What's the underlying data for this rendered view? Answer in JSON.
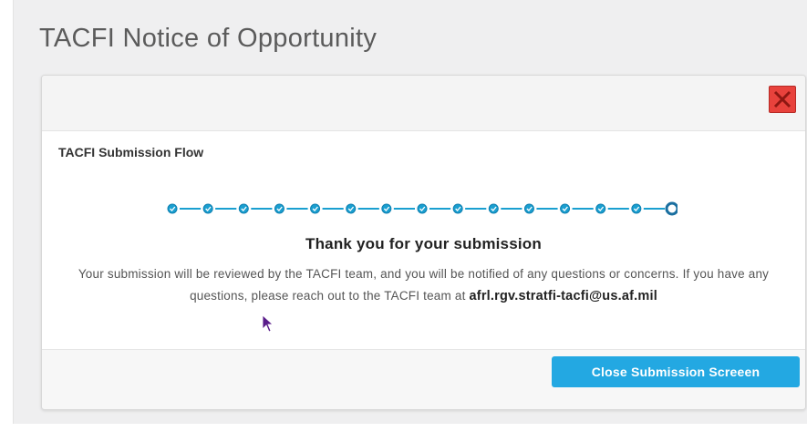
{
  "page": {
    "title": "TACFI Notice of Opportunity"
  },
  "modal": {
    "flow_title": "TACFI Submission Flow",
    "stepper": {
      "total_steps": 15,
      "completed_steps": 14,
      "step_color": "#1a9fd0",
      "current_color": "#1a6fa0"
    },
    "heading": "Thank you for your submission",
    "message": "Your submission will be reviewed by the TACFI team, and you will be notified of any questions or concerns. If you have any questions, please reach out to the TACFI team at",
    "email": "afrl.rgv.stratfi-tacfi@us.af.mil",
    "close_icon": "close-x-icon",
    "footer": {
      "button_label": "Close Submission Screeen"
    }
  },
  "colors": {
    "primary": "#23a8e2",
    "danger": "#e8423c",
    "background": "#efeff0"
  }
}
